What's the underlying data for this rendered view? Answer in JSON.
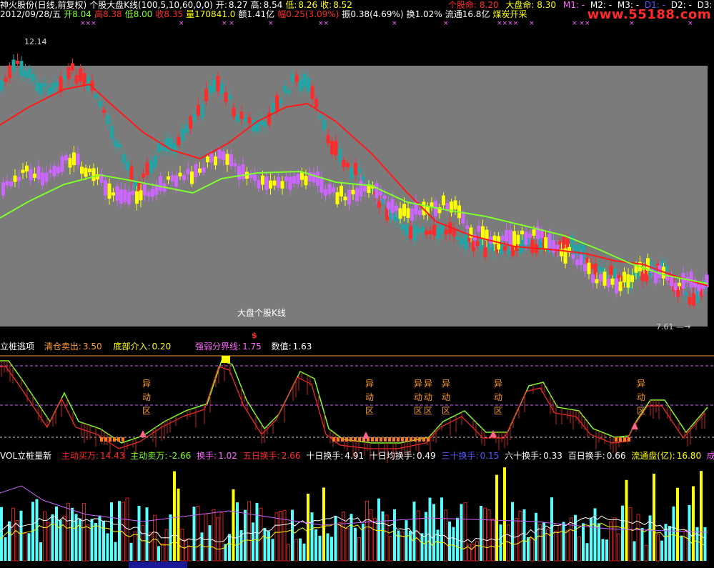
{
  "header": {
    "stock": "神火股份(日线,前复权)",
    "indicator": "个股大盘K线(100,5,10,60,0,0)",
    "open_label": "开:",
    "open": "8.27",
    "high_label": "高:",
    "high": "8.54",
    "low_label": "低:",
    "low": "8.26",
    "close_label": "收:",
    "close": "8.52",
    "stock_life_label": "个股命:",
    "stock_life": "8.20",
    "market_life_label": "大盘命:",
    "market_life": "8.30",
    "m1": "M1: -",
    "m2": "M2: -",
    "m3": "M3: -",
    "d1": "D1: -",
    "d2": "D2: -",
    "d3": "D3: -",
    "watermark": "www.55188.com"
  },
  "info_bar": {
    "date": "2012/09/28/五",
    "open": "开8.04",
    "high": "高8.38",
    "low": "低8.00",
    "close": "收8.35",
    "volume": "量170841.0",
    "amount": "额1.41亿",
    "change": "幅0.25(3.09%)",
    "amplitude": "振0.38(4.69%)",
    "turnover": "换1.02%",
    "float": "流通16.8亿",
    "sector": "煤炭开采"
  },
  "kline_panel": {
    "label": "大盘个股K线",
    "high_price": "12.14",
    "low_price": "7.61",
    "arrow_symbol": "$"
  },
  "indicator_panel": {
    "name": "立桩逃项",
    "clear_label": "清仓卖出:",
    "clear_value": "3.50",
    "bottom_label": "底部介入:",
    "bottom_value": "0.20",
    "split_label": "强弱分界线:",
    "split_value": "1.75",
    "value_label": "数值:",
    "value": "1.63",
    "zone_chars": [
      "异",
      "动",
      "区"
    ]
  },
  "volume_panel": {
    "name": "VOL立桩量新",
    "buy_label": "主动买万:",
    "buy_value": "14.43",
    "sell_label": "主动卖万:",
    "sell_value": "-2.66",
    "t1_label": "换手:",
    "t1_value": "1.02",
    "t5_label": "五日换手:",
    "t5_value": "2.66",
    "t10_label": "十日换手:",
    "t10_value": "4.91",
    "t10avg_label": "十日均换手:",
    "t10avg_value": "0.49",
    "t30_label": "三十换手:",
    "t30_value": "0.15",
    "t60_label": "六十换手:",
    "t60_value": "0.33",
    "t100_label": "百日换手:",
    "t100_value": "0.66",
    "float_cap_label": "流通盘(亿):",
    "float_cap_value": "16.80",
    "amount_label": "成交额("
  },
  "colors": {
    "up": "#ff2a2a",
    "down": "#1fa7a7",
    "yellow": "#ffff00",
    "magenta": "#cc66ff",
    "ma_red": "#ff1a1a",
    "ma_green": "#7cff2a",
    "cyan_vol": "#55ffff"
  }
}
